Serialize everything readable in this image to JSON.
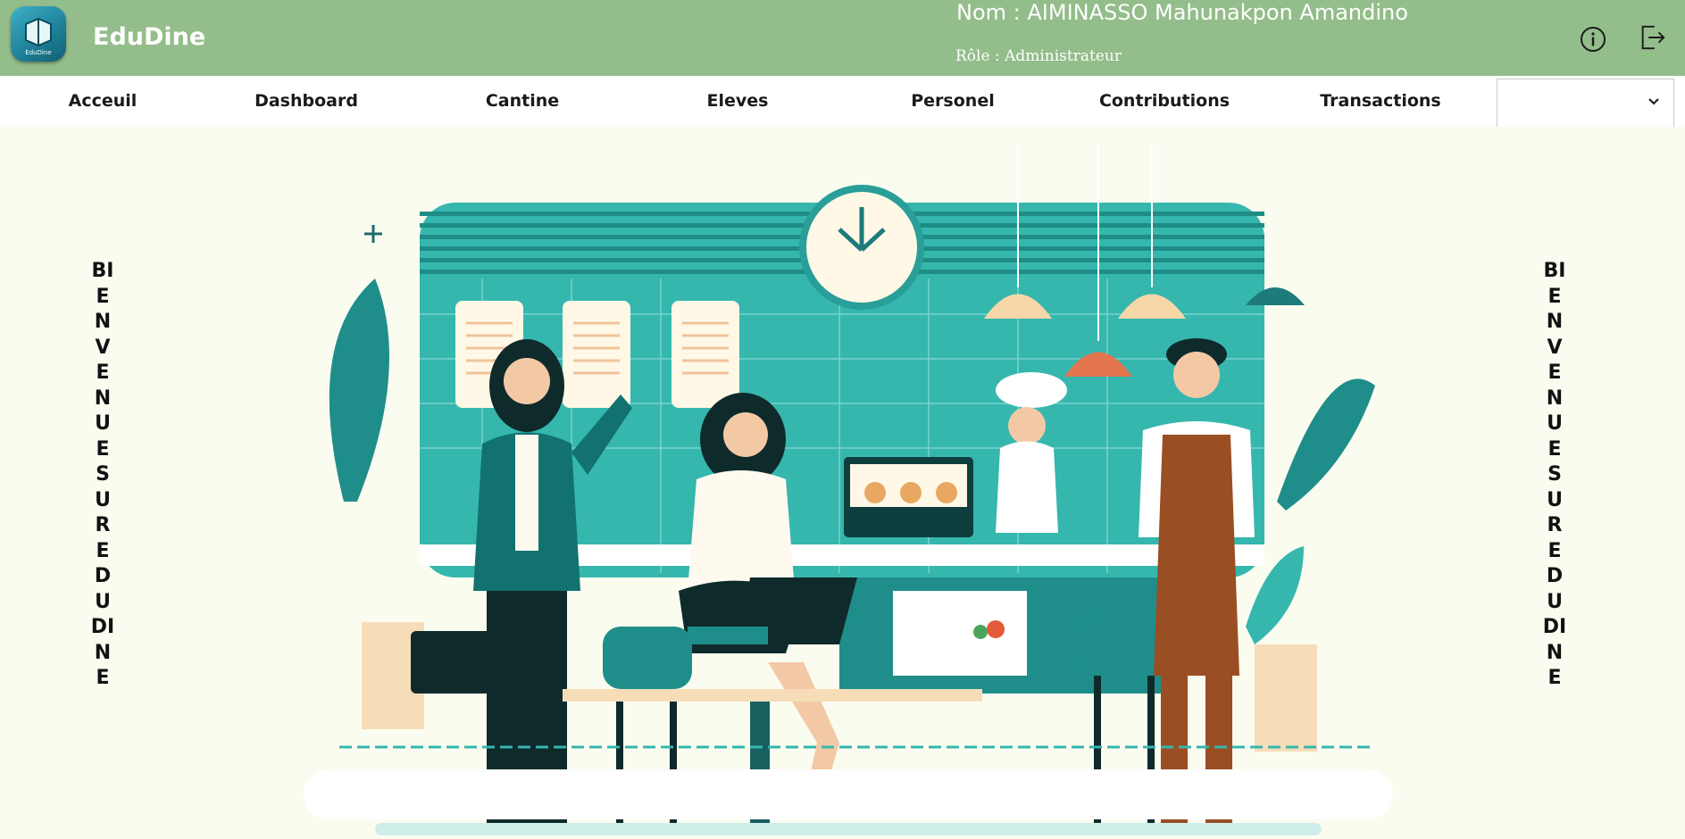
{
  "header": {
    "app_title": "EduDine",
    "logo_text": "EduDine",
    "user_name": "Nom : AIMINASSO Mahunakpon Amandino",
    "user_role": "Rôle : Administrateur",
    "icons": [
      "info-icon",
      "logout-icon"
    ]
  },
  "nav": {
    "items": [
      {
        "label": "Acceuil"
      },
      {
        "label": "Dashboard"
      },
      {
        "label": "Cantine"
      },
      {
        "label": "Eleves"
      },
      {
        "label": "Personel"
      },
      {
        "label": "Contributions"
      },
      {
        "label": "Transactions"
      }
    ],
    "select_value": ""
  },
  "main": {
    "side_text_left": "BIENVENUE SUR EDUDINE",
    "side_text_right": "BIENVENUE SUR EDUDINE"
  },
  "colors": {
    "header_bg": "#93bd8a",
    "teal": "#26a6a0",
    "dark_teal": "#0f6e70",
    "page_bg": "#fbfcf0"
  }
}
